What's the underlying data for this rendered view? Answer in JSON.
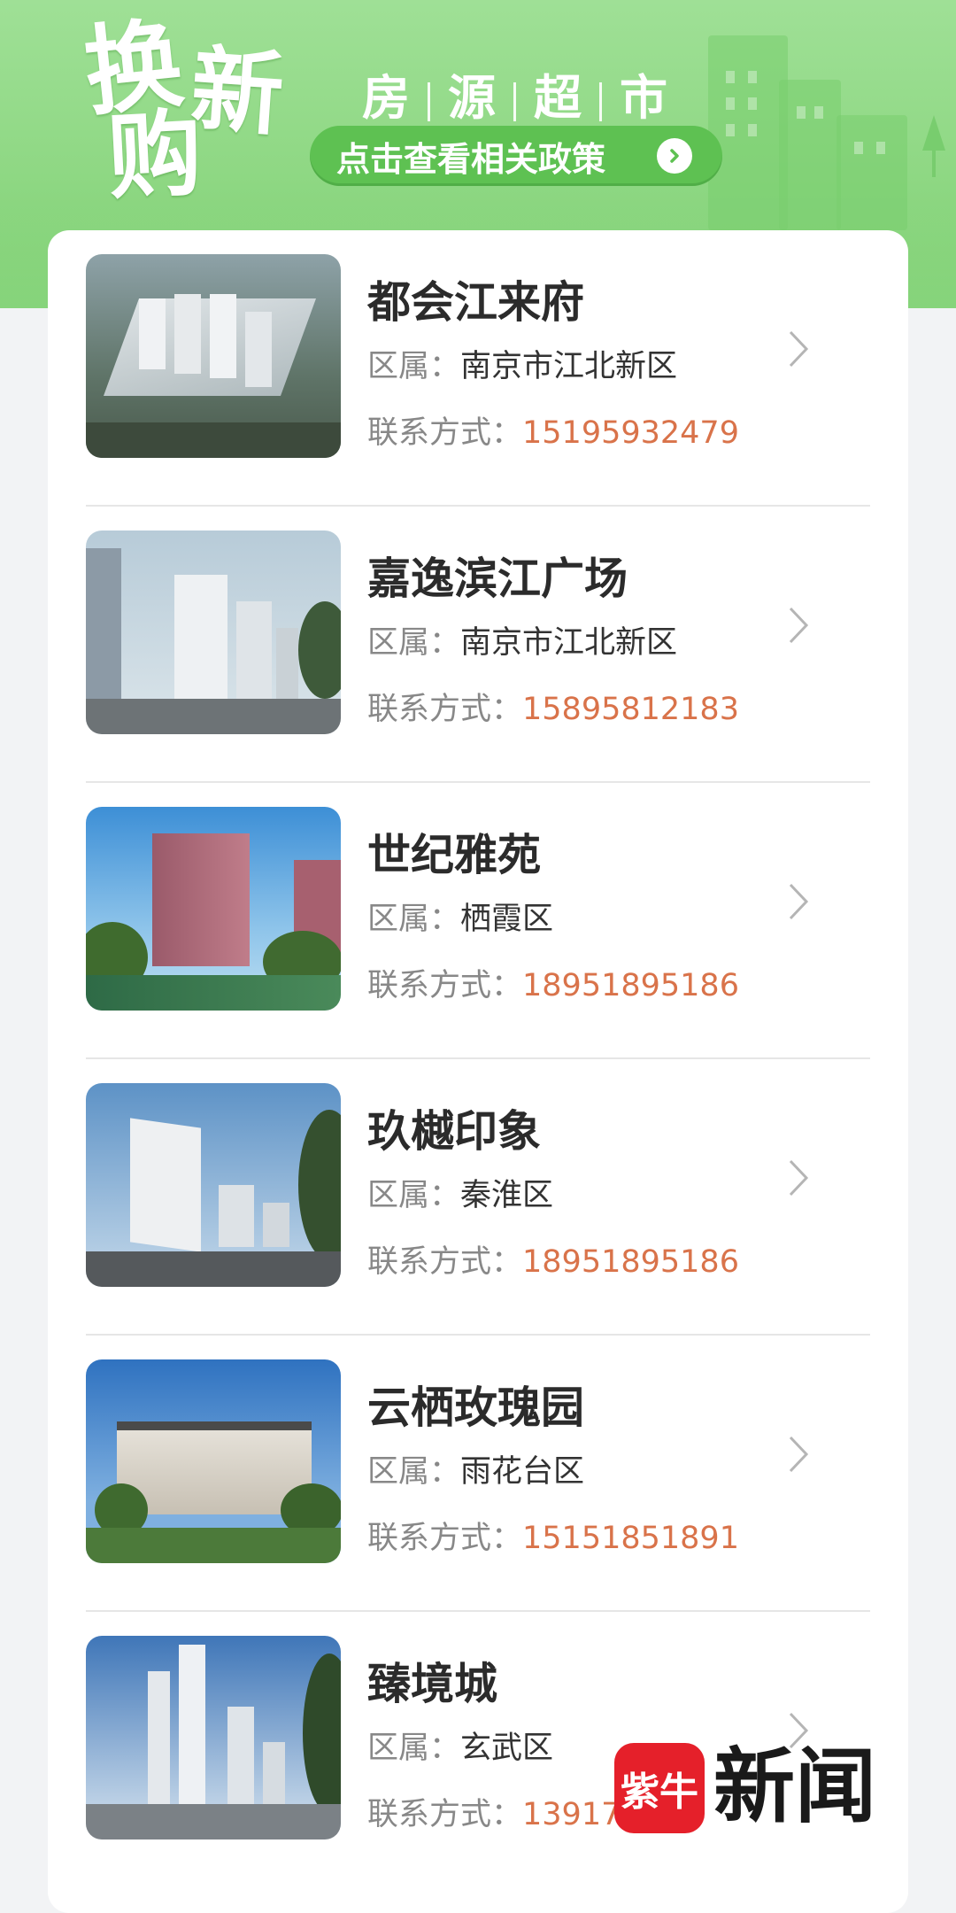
{
  "banner": {
    "brand_chars": [
      "换",
      "新",
      "购"
    ],
    "market_chars": [
      "房",
      "源",
      "超",
      "市"
    ],
    "policy_label": "点击查看相关政策"
  },
  "listings": [
    {
      "name": "都会江来府",
      "district_label": "区属：",
      "district": "南京市江北新区",
      "contact_label": "联系方式：",
      "phone": "15195932479"
    },
    {
      "name": "嘉逸滨江广场",
      "district_label": "区属：",
      "district": "南京市江北新区",
      "contact_label": "联系方式：",
      "phone": "15895812183"
    },
    {
      "name": "世纪雅苑",
      "district_label": "区属：",
      "district": "栖霞区",
      "contact_label": "联系方式：",
      "phone": "18951895186"
    },
    {
      "name": "玖樾印象",
      "district_label": "区属：",
      "district": "秦淮区",
      "contact_label": "联系方式：",
      "phone": "18951895186"
    },
    {
      "name": "云栖玫瑰园",
      "district_label": "区属：",
      "district": "雨花台区",
      "contact_label": "联系方式：",
      "phone": "15151851891"
    },
    {
      "name": "臻境城",
      "district_label": "区属：",
      "district": "玄武区",
      "contact_label": "联系方式：",
      "phone": "139177"
    }
  ],
  "watermark": {
    "logo": "紫牛",
    "text": "新闻"
  },
  "colors": {
    "accent_green": "#5ec152",
    "phone": "#d9734a",
    "watermark_red": "#e5202a"
  }
}
